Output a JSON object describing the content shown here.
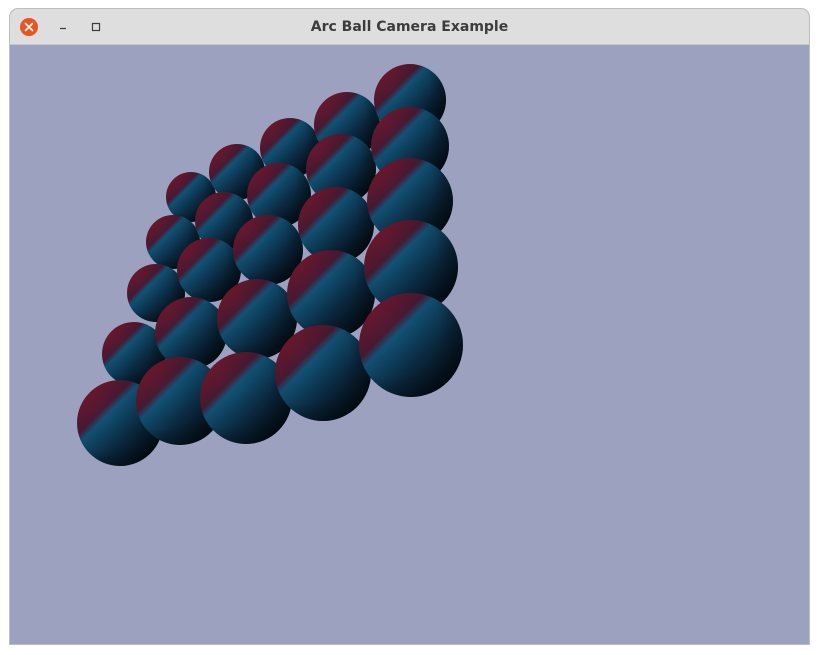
{
  "window": {
    "title": "Arc Ball Camera Example",
    "buttons": {
      "close_icon": "close-icon",
      "minimize_icon": "minimize-icon",
      "maximize_icon": "maximize-icon"
    }
  },
  "scene": {
    "background_color": "#9ca1bf",
    "sphere_count": 25,
    "light_colors": {
      "red": "#8a1526",
      "blue": "#12557a",
      "shadow": "#03050a"
    }
  }
}
